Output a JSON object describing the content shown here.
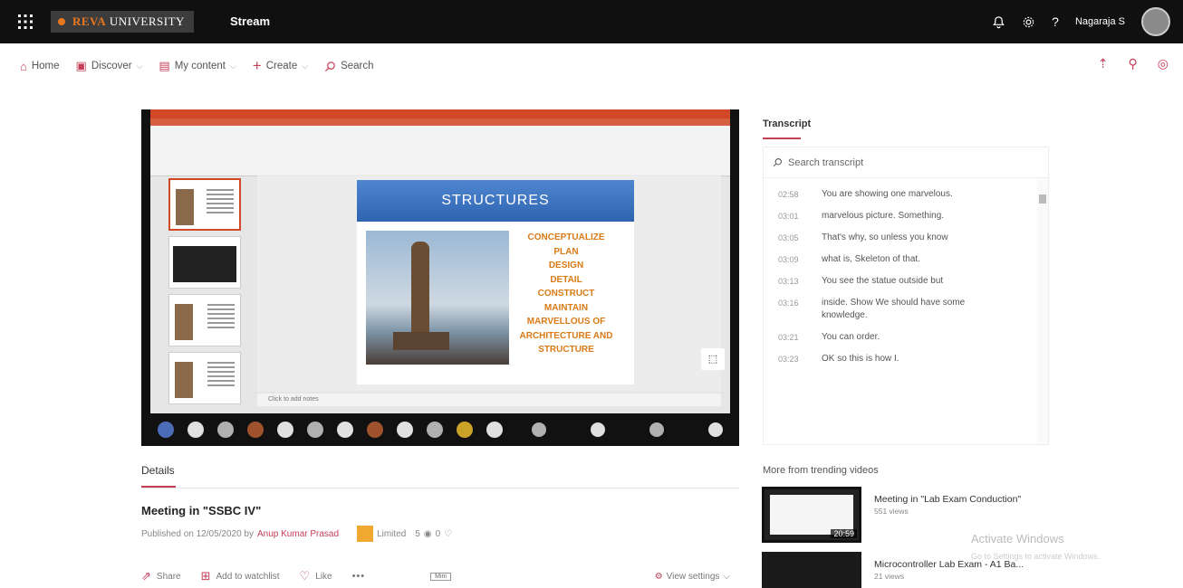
{
  "topbar": {
    "brand_reva": "REVA",
    "brand_university": "UNIVERSITY",
    "app_name": "Stream",
    "user_name": "Nagaraja S"
  },
  "nav": {
    "home": "Home",
    "discover": "Discover",
    "my_content": "My content",
    "create": "Create",
    "search": "Search"
  },
  "video": {
    "slide_title": "STRUCTURES",
    "slide_items": [
      "CONCEPTUALIZE",
      "PLAN",
      "DESIGN",
      "DETAIL",
      "CONSTRUCT",
      "MAINTAIN",
      "MARVELLOUS OF ARCHITECTURE AND STRUCTURE"
    ],
    "notes_placeholder": "Click to add notes"
  },
  "details": {
    "tab_label": "Details",
    "meeting_title": "Meeting in \"SSBC IV\"",
    "published_prefix": "Published on 12/05/2020 by",
    "author": "Anup Kumar Prasad",
    "limited": "Limited",
    "views": "5",
    "likes": "0",
    "actions": {
      "share": "Share",
      "watchlist": "Add to watchlist",
      "like": "Like",
      "more": "•••",
      "mini": "Mini",
      "view_settings": "View settings"
    }
  },
  "transcript": {
    "title": "Transcript",
    "search_placeholder": "Search transcript",
    "rows": [
      {
        "time": "02:58",
        "text": "You are showing one marvelous."
      },
      {
        "time": "03:01",
        "text": "marvelous picture. Something."
      },
      {
        "time": "03:05",
        "text": "That's why, so unless you know"
      },
      {
        "time": "03:09",
        "text": "what is, Skeleton of that."
      },
      {
        "time": "03:13",
        "text": "You see the statue outside but"
      },
      {
        "time": "03:16",
        "text": "inside. Show We should have some knowledge."
      },
      {
        "time": "03:21",
        "text": "You can order."
      },
      {
        "time": "03:23",
        "text": "OK so this is how I."
      }
    ]
  },
  "trending": {
    "title": "More from trending videos",
    "videos": [
      {
        "title": "Meeting in \"Lab Exam Conduction\"",
        "views": "551 views",
        "duration": "20:59"
      },
      {
        "title": "Microcontroller Lab Exam - A1 Ba...",
        "views": "21 views",
        "duration": ""
      }
    ]
  },
  "watermark": {
    "title": "Activate Windows",
    "subtitle": "Go to Settings to activate Windows."
  },
  "colors": {
    "accent": "#c43e55",
    "topbar": "#101010",
    "ppt_orange": "#d24726",
    "slide_blue": "#2e64b0",
    "slide_text": "#d97a16"
  }
}
